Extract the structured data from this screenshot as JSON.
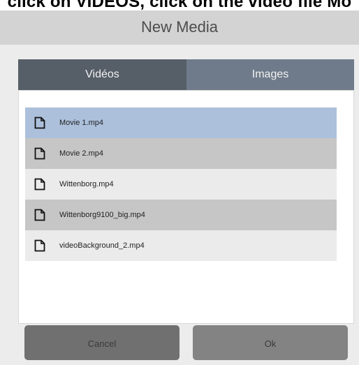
{
  "instruction": "click on VIDEOS, click on the video file Mo",
  "dialog": {
    "title": "New Media",
    "tabs": [
      {
        "label": "Vidéos"
      },
      {
        "label": "Images"
      }
    ],
    "files": [
      {
        "name": "Movie 1.mp4",
        "state": "selected"
      },
      {
        "name": "Movie 2.mp4",
        "state": "gray"
      },
      {
        "name": "Wittenborg.mp4",
        "state": "light"
      },
      {
        "name": "Wittenborg9100_big.mp4",
        "state": "gray"
      },
      {
        "name": "videoBackground_2.mp4",
        "state": "light"
      }
    ],
    "buttons": {
      "cancel": "Cancel",
      "ok": "Ok"
    }
  },
  "colors": {
    "header_bg": "#d3d3d3",
    "dialog_bg": "#ececec",
    "tab_active": "#565e68",
    "tab_inactive": "#6f7b8a",
    "row_selected": "#acc0dc",
    "row_gray": "#c6c6c6",
    "row_light": "#ebebeb"
  },
  "icons": [
    "file-icon"
  ]
}
